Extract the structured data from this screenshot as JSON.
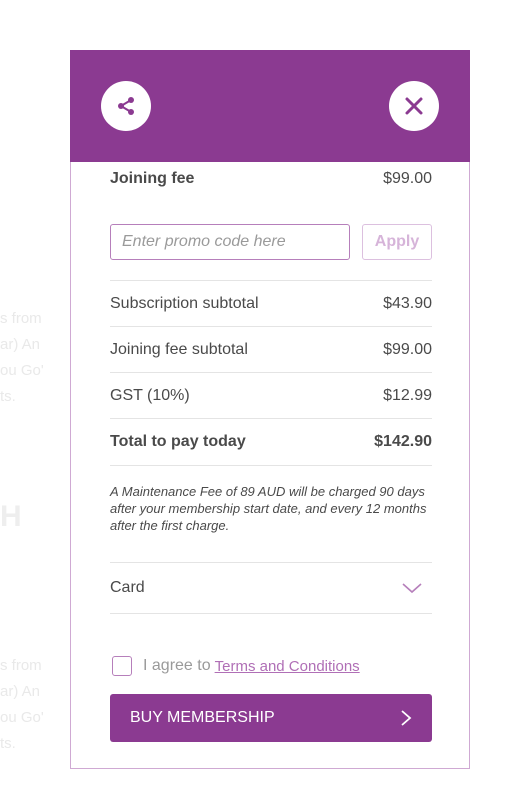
{
  "background": {
    "text_block_1": [
      "s from",
      "ar) An",
      "ou Go'",
      "ts."
    ],
    "heading": "H",
    "text_block_2": [
      "s from",
      "ar) An",
      "ou Go'",
      "ts."
    ]
  },
  "header": {
    "share_icon": "share-icon",
    "close_icon": "close-icon",
    "color": "#8b3a91"
  },
  "joining_fee": {
    "label": "Joining fee",
    "value": "$99.00"
  },
  "promo": {
    "placeholder": "Enter promo code here",
    "apply_label": "Apply"
  },
  "totals": [
    {
      "label": "Subscription subtotal",
      "value": "$43.90"
    },
    {
      "label": "Joining fee subtotal",
      "value": "$99.00"
    },
    {
      "label": "GST (10%)",
      "value": "$12.99"
    }
  ],
  "total_today": {
    "label": "Total to pay today",
    "value": "$142.90"
  },
  "note": "A Maintenance Fee of 89 AUD will be charged 90 days after your membership start date, and every 12 months after the first charge.",
  "payment_method": {
    "selected": "Card",
    "icon": "chevron-down-icon"
  },
  "agreement": {
    "prefix": "I agree to",
    "link": "Terms and Conditions"
  },
  "buy_button": {
    "label": "BUY MEMBERSHIP",
    "icon": "chevron-right-icon"
  },
  "colors": {
    "accent": "#8b3a91",
    "border": "#cfa9d3"
  }
}
